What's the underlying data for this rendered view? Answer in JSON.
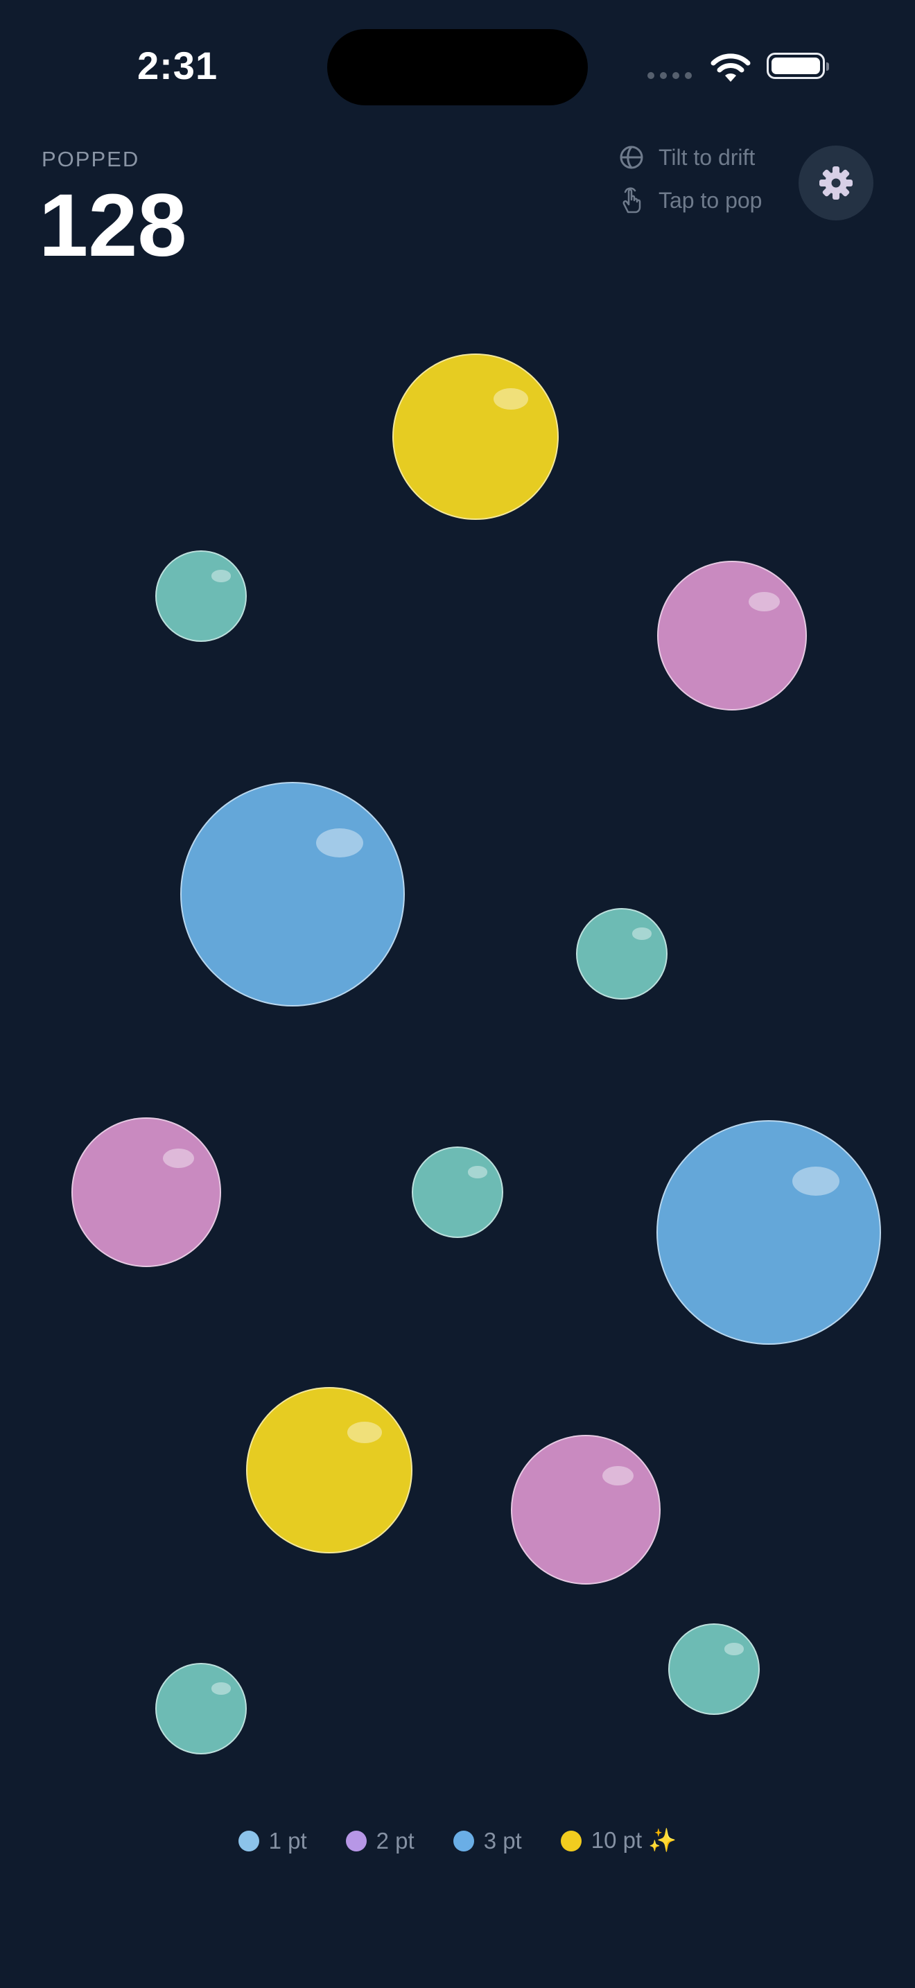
{
  "status_bar": {
    "time": "2:31"
  },
  "header": {
    "popped_label": "POPPED",
    "popped_count": "128",
    "hints": {
      "tilt": "Tilt to drift",
      "tap": "Tap to pop"
    },
    "settings_icon": "gear-icon"
  },
  "bubbles": [
    {
      "kind": "yellow"
    },
    {
      "kind": "teal"
    },
    {
      "kind": "pink"
    },
    {
      "kind": "blue"
    },
    {
      "kind": "teal"
    },
    {
      "kind": "pink"
    },
    {
      "kind": "teal"
    },
    {
      "kind": "blue"
    },
    {
      "kind": "yellow"
    },
    {
      "kind": "pink"
    },
    {
      "kind": "teal"
    },
    {
      "kind": "teal"
    }
  ],
  "colors": {
    "background": "#0f1b2d",
    "yellow": "#e6cc22",
    "teal": "#6dbbb4",
    "pink": "#c98ac0",
    "blue": "#64a7d9",
    "legend_1pt": "#8cc3ea",
    "legend_2pt": "#b797e6",
    "legend_3pt": "#6aaee6",
    "legend_10pt": "#f2cc1f"
  },
  "legend": [
    {
      "label": "1 pt",
      "color": "#8cc3ea"
    },
    {
      "label": "2 pt",
      "color": "#b797e6"
    },
    {
      "label": "3 pt",
      "color": "#6aaee6"
    },
    {
      "label": "10 pt ✨",
      "color": "#f2cc1f"
    }
  ]
}
